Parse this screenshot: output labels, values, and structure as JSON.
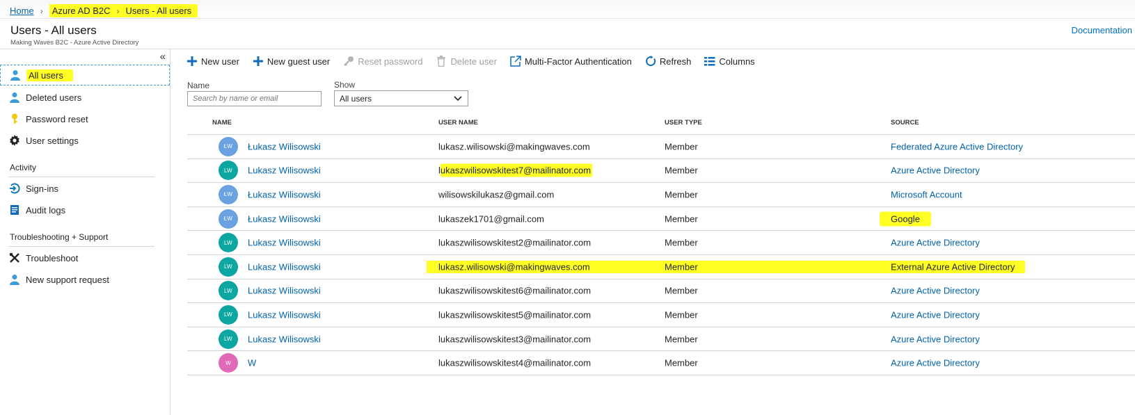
{
  "breadcrumb": {
    "home": "Home",
    "b2c": "Azure AD B2C",
    "current": "Users - All users"
  },
  "header": {
    "title": "Users - All users",
    "subtitle": "Making Waves B2C - Azure Active Directory",
    "documentation": "Documentation"
  },
  "sidebar": {
    "collapse": "«",
    "items": [
      {
        "label": "All users",
        "icon": "user-icon"
      },
      {
        "label": "Deleted users",
        "icon": "user-icon"
      },
      {
        "label": "Password reset",
        "icon": "key-icon"
      },
      {
        "label": "User settings",
        "icon": "gear-icon"
      }
    ],
    "activity_heading": "Activity",
    "activity": [
      {
        "label": "Sign-ins",
        "icon": "sign-in-icon"
      },
      {
        "label": "Audit logs",
        "icon": "audit-log-icon"
      }
    ],
    "support_heading": "Troubleshooting + Support",
    "support": [
      {
        "label": "Troubleshoot",
        "icon": "wrench-icon"
      },
      {
        "label": "New support request",
        "icon": "support-person-icon"
      }
    ]
  },
  "toolbar": {
    "new_user": "New user",
    "new_guest": "New guest user",
    "reset_password": "Reset password",
    "delete_user": "Delete user",
    "mfa": "Multi-Factor Authentication",
    "refresh": "Refresh",
    "columns": "Columns"
  },
  "filters": {
    "name_label": "Name",
    "name_placeholder": "Search by name or email",
    "show_label": "Show",
    "show_value": "All users"
  },
  "table": {
    "headers": {
      "name": "NAME",
      "user_name": "USER NAME",
      "user_type": "USER TYPE",
      "source": "SOURCE"
    },
    "rows": [
      {
        "initials": "ŁW",
        "name": "Łukasz Wilisowski",
        "user_name": "lukasz.wilisowski@makingwaves.com",
        "user_type": "Member",
        "source": "Federated Azure Active Directory"
      },
      {
        "initials": "LW",
        "name": "Lukasz Wilisowski",
        "user_name_prefix": "l",
        "user_name": "ukaszwilisowskitest7@mailinator.com",
        "user_type": "Member",
        "source": "Azure Active Directory"
      },
      {
        "initials": "ŁW",
        "name": "Łukasz Wilisowski",
        "user_name": "wilisowskilukasz@gmail.com",
        "user_type": "Member",
        "source": "Microsoft Account"
      },
      {
        "initials": "ŁW",
        "name": "Łukasz Wilisowski",
        "user_name": "lukaszek1701@gmail.com",
        "user_type": "Member",
        "source": "Google"
      },
      {
        "initials": "LW",
        "name": "Lukasz Wilisowski",
        "user_name": "lukaszwilisowskitest2@mailinator.com",
        "user_type": "Member",
        "source": "Azure Active Directory"
      },
      {
        "initials": "LW",
        "name": "Lukasz Wilisowski",
        "user_name": "lukasz.wilisowski@makingwaves.com",
        "user_type": "Member",
        "source": "External Azure Active Directory"
      },
      {
        "initials": "LW",
        "name": "Lukasz Wilisowski",
        "user_name": "lukaszwilisowskitest6@mailinator.com",
        "user_type": "Member",
        "source": "Azure Active Directory"
      },
      {
        "initials": "LW",
        "name": "Lukasz Wilisowski",
        "user_name": "lukaszwilisowskitest5@mailinator.com",
        "user_type": "Member",
        "source": "Azure Active Directory"
      },
      {
        "initials": "LW",
        "name": "Lukasz Wilisowski",
        "user_name": "lukaszwilisowskitest3@mailinator.com",
        "user_type": "Member",
        "source": "Azure Active Directory"
      },
      {
        "initials": "W",
        "name": "W",
        "user_name": "lukaszwilisowskitest4@mailinator.com",
        "user_type": "Member",
        "source": "Azure Active Directory"
      }
    ]
  },
  "colors": {
    "highlight": "#ffff26",
    "link": "#0062ad",
    "avatar_blue": "#6aa1e0",
    "avatar_teal": "#0ea6a0",
    "avatar_pink": "#e268b8",
    "accent_blue": "#0078d4"
  }
}
